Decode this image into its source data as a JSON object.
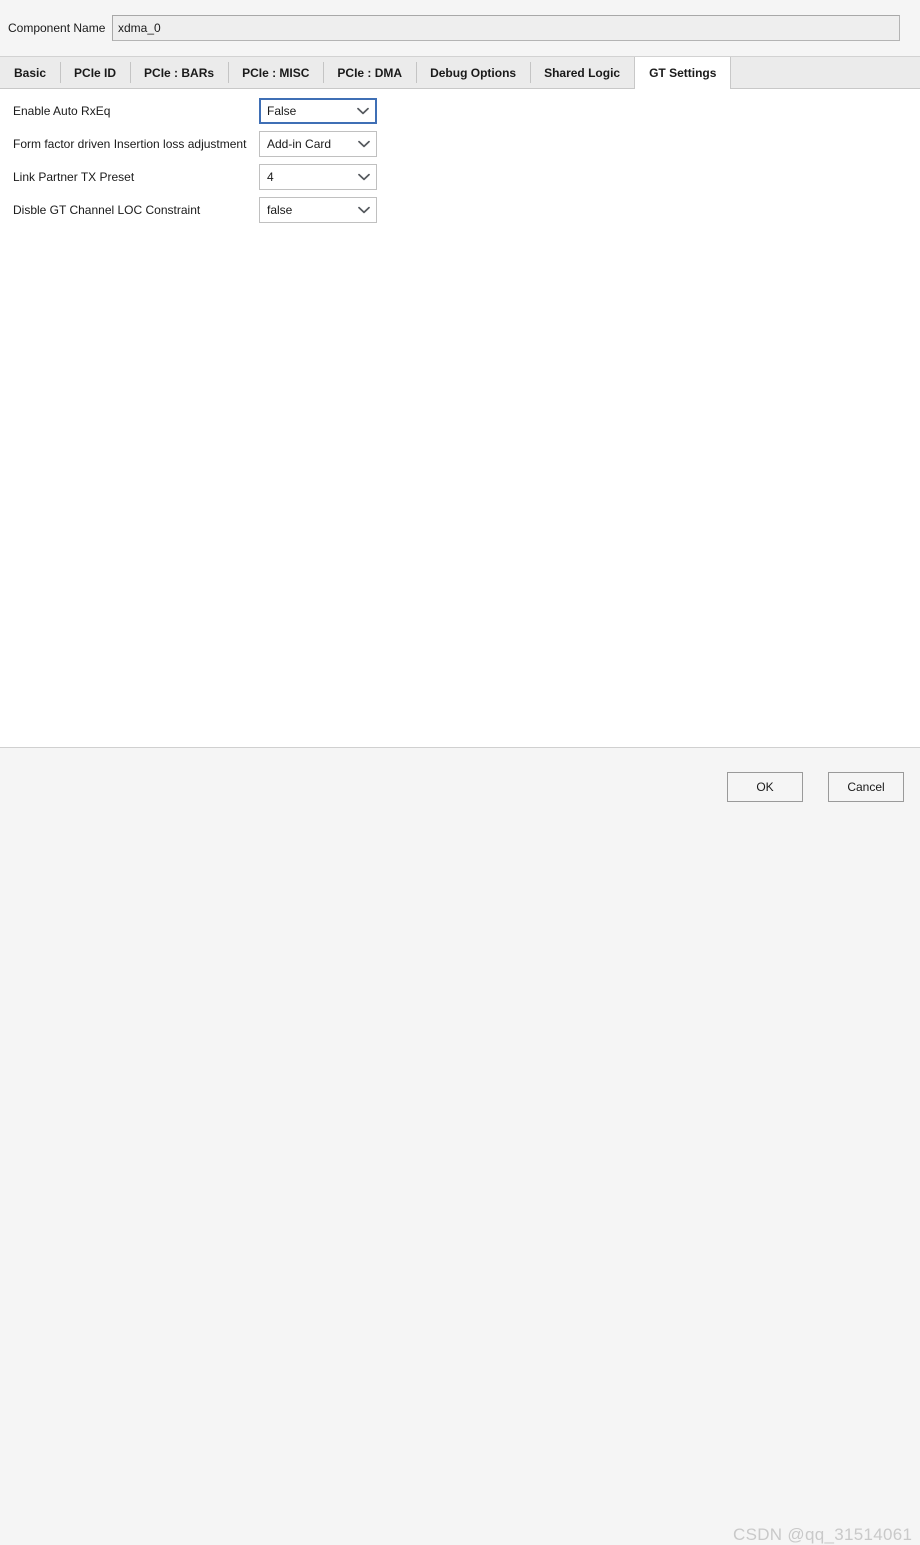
{
  "header": {
    "component_name_label": "Component Name",
    "component_name_value": "xdma_0"
  },
  "tabs": [
    {
      "label": "Basic",
      "active": false
    },
    {
      "label": "PCIe ID",
      "active": false
    },
    {
      "label": "PCIe : BARs",
      "active": false
    },
    {
      "label": "PCIe : MISC",
      "active": false
    },
    {
      "label": "PCIe : DMA",
      "active": false
    },
    {
      "label": "Debug Options",
      "active": false
    },
    {
      "label": "Shared Logic",
      "active": false
    },
    {
      "label": "GT Settings",
      "active": true
    }
  ],
  "form": {
    "rows": [
      {
        "label": "Enable Auto RxEq",
        "value": "False",
        "focused": true,
        "name": "enable-auto-rxeq"
      },
      {
        "label": "Form factor driven Insertion loss adjustment",
        "value": "Add-in Card",
        "focused": false,
        "name": "form-factor-insertion-loss"
      },
      {
        "label": "Link Partner TX Preset",
        "value": "4",
        "focused": false,
        "name": "link-partner-tx-preset"
      },
      {
        "label": "Disble GT Channel LOC Constraint",
        "value": "false",
        "focused": false,
        "name": "disable-gt-channel-loc-constraint"
      }
    ]
  },
  "footer": {
    "ok_label": "OK",
    "cancel_label": "Cancel"
  },
  "watermark": {
    "text": "CSDN @qq_31514061"
  },
  "colors": {
    "focus_border": "#3f6fb5",
    "panel_background": "#ffffff",
    "window_background": "#f5f5f5",
    "tab_strip_background": "#ebebeb",
    "watermark_text": "#c9c9c9"
  }
}
